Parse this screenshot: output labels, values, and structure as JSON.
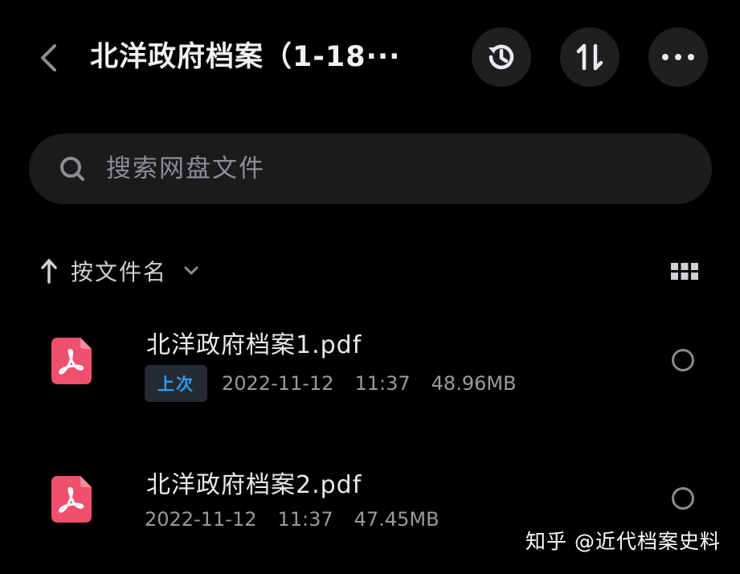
{
  "header": {
    "title": "北洋政府档案（1-18···",
    "icons": {
      "back": "chevron-left-icon",
      "history": "history-icon",
      "sort": "sort-order-icon",
      "more": "more-dots-icon"
    }
  },
  "search": {
    "placeholder": "搜索网盘文件",
    "icon": "search-icon"
  },
  "sort": {
    "label": "按文件名",
    "direction_icon": "arrow-up-icon",
    "dropdown_icon": "chevron-down-icon",
    "view_toggle_icon": "grid-view-icon"
  },
  "files": [
    {
      "name": "北洋政府档案1.pdf",
      "badge": "上次",
      "date": "2022-11-12",
      "time": "11:37",
      "size": "48.96MB",
      "icon": "pdf-file-icon"
    },
    {
      "name": "北洋政府档案2.pdf",
      "date": "2022-11-12",
      "time": "11:37",
      "size": "47.45MB",
      "icon": "pdf-file-icon"
    }
  ],
  "watermark": "知乎 @近代档案史料",
  "colors": {
    "background": "#000000",
    "surface": "#1b1b1d",
    "accent_blue": "#2c9df5",
    "pdf_red": "#f0506e"
  }
}
